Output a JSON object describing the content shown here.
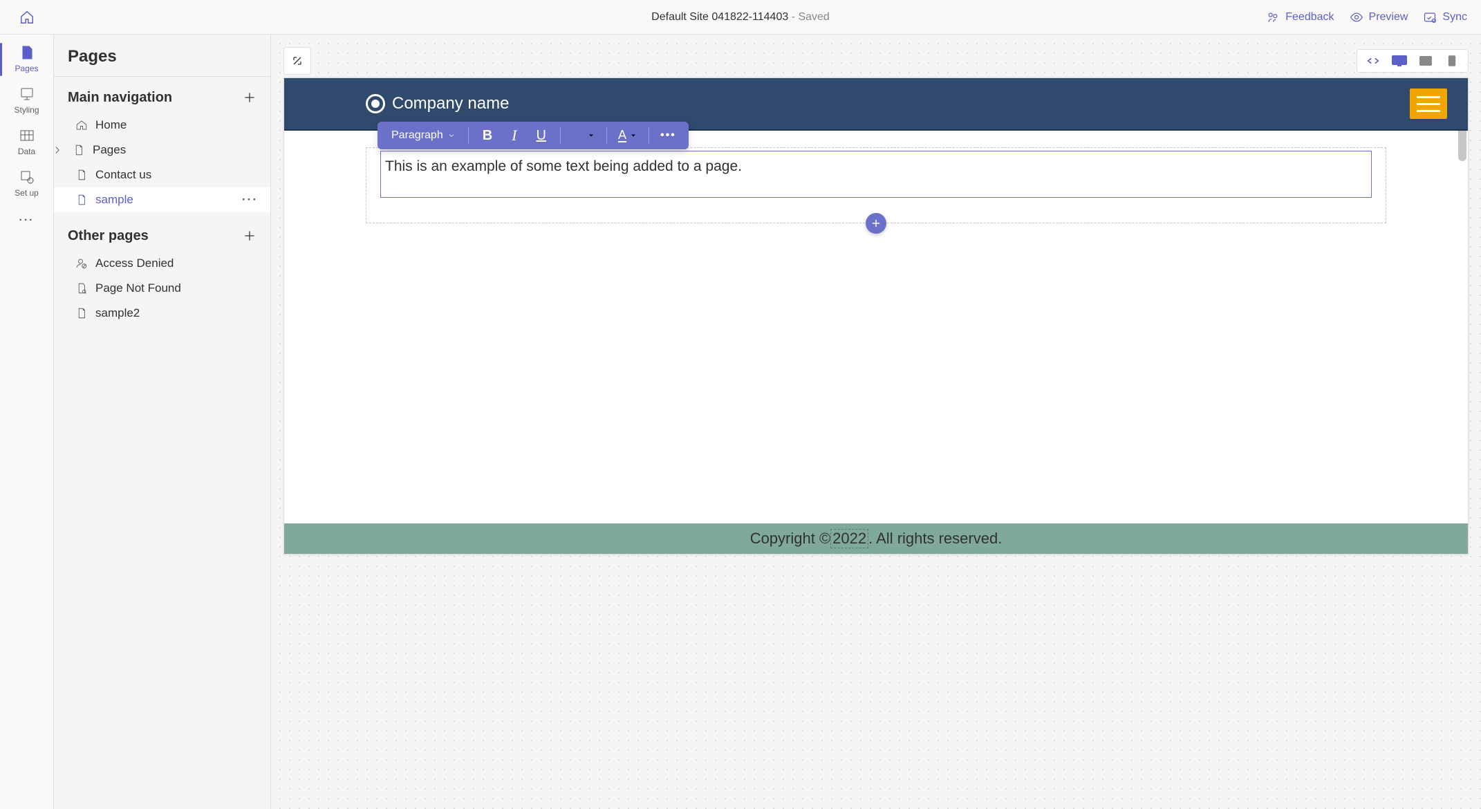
{
  "header": {
    "site_name": "Default Site 041822-114403",
    "saved_suffix": " - Saved",
    "actions": {
      "feedback": "Feedback",
      "preview": "Preview",
      "sync": "Sync"
    }
  },
  "rail": {
    "pages": "Pages",
    "styling": "Styling",
    "data": "Data",
    "setup": "Set up"
  },
  "side_panel": {
    "title": "Pages",
    "main_nav_title": "Main navigation",
    "other_pages_title": "Other pages",
    "main_nav": [
      {
        "label": "Home",
        "icon": "home"
      },
      {
        "label": "Pages",
        "icon": "page-chevron"
      },
      {
        "label": "Contact us",
        "icon": "page"
      },
      {
        "label": "sample",
        "icon": "page",
        "selected": true
      }
    ],
    "other_pages": [
      {
        "label": "Access Denied",
        "icon": "person-block"
      },
      {
        "label": "Page Not Found",
        "icon": "page-x"
      },
      {
        "label": "sample2",
        "icon": "page"
      }
    ]
  },
  "editor_toolbar": {
    "paragraph_label": "Paragraph"
  },
  "preview_site": {
    "brand": "Company name",
    "text_block": "This is an example of some text being added to a page.",
    "footer_prefix": "Copyright © ",
    "footer_year": "2022",
    "footer_suffix": ". All rights reserved."
  }
}
